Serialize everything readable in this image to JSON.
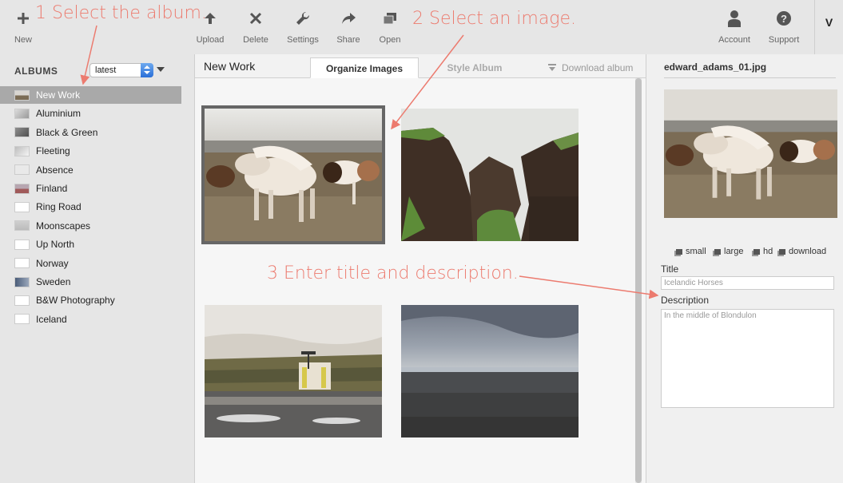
{
  "toolbar": {
    "left": [
      {
        "label": "New",
        "icon": "plus-icon"
      }
    ],
    "center": [
      {
        "label": "Upload",
        "icon": "upload-arrow-icon"
      },
      {
        "label": "Delete",
        "icon": "x-icon"
      },
      {
        "label": "Settings",
        "icon": "wrench-icon"
      },
      {
        "label": "Share",
        "icon": "share-arrow-icon"
      },
      {
        "label": "Open",
        "icon": "open-windows-icon"
      }
    ],
    "right": [
      {
        "label": "Account",
        "icon": "person-icon"
      },
      {
        "label": "Support",
        "icon": "question-circle-icon"
      }
    ],
    "indicator": "V"
  },
  "sidebar": {
    "heading": "ALBUMS",
    "sort_value": "latest",
    "albums": [
      {
        "label": "New Work",
        "active": true
      },
      {
        "label": "Aluminium"
      },
      {
        "label": "Black & Green"
      },
      {
        "label": "Fleeting"
      },
      {
        "label": "Absence"
      },
      {
        "label": "Finland"
      },
      {
        "label": "Ring Road"
      },
      {
        "label": "Moonscapes"
      },
      {
        "label": "Up North"
      },
      {
        "label": "Norway"
      },
      {
        "label": "Sweden"
      },
      {
        "label": "B&W Photography"
      },
      {
        "label": "Iceland"
      }
    ]
  },
  "center": {
    "title": "New Work",
    "tabs": [
      {
        "label": "Organize Images",
        "active": true
      },
      {
        "label": "Style Album",
        "active": false
      }
    ],
    "download_label": "Download album",
    "images": [
      {
        "name": "horses",
        "selected": true
      },
      {
        "name": "cliffs"
      },
      {
        "name": "gas-station"
      },
      {
        "name": "lava-field"
      }
    ]
  },
  "details": {
    "filename": "edward_adams_01.jpg",
    "sizes": [
      "small",
      "large",
      "hd",
      "download"
    ],
    "title_label": "Title",
    "title_value": "Icelandic Horses",
    "description_label": "Description",
    "description_value": "In the middle of Blondulon"
  },
  "annotations": [
    {
      "text": "1 Select the album."
    },
    {
      "text": "2 Select an image."
    },
    {
      "text": "3 Enter title and description."
    }
  ],
  "colors": {
    "annotation": "#ec7b6f",
    "active_album_bg": "#a9a9a9",
    "toolbar_bg": "#e6e6e6"
  }
}
